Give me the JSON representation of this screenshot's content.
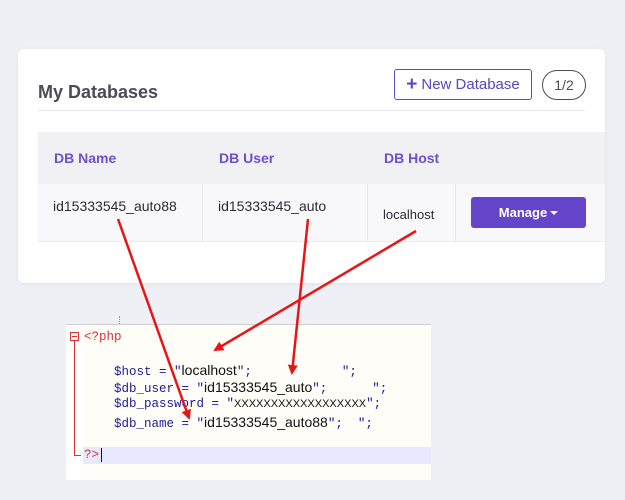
{
  "card": {
    "title": "My Databases",
    "new_button_label": "New Database",
    "new_button_icon": "plus-icon",
    "pager_label": "1/2"
  },
  "table": {
    "columns": [
      "DB Name",
      "DB User",
      "DB Host"
    ],
    "rows": [
      {
        "db_name": "id15333545_auto88",
        "db_user": "id15333545_auto",
        "db_host": "localhost",
        "action_label": "Manage"
      }
    ]
  },
  "code": {
    "open_tag": "<?php",
    "close_tag": "?>",
    "lines": [
      {
        "var": "$host",
        "value": "localhost"
      },
      {
        "var": "$db_user",
        "value": "id15333545_auto"
      },
      {
        "var": "$db_password",
        "value": "XXXXXXXXXXXXXXXXXX"
      },
      {
        "var": "$db_name",
        "value": "id15333545_auto88"
      }
    ]
  },
  "colors": {
    "accent": "#6445c9",
    "arrow": "#e81515",
    "php_tag": "#e03030"
  }
}
